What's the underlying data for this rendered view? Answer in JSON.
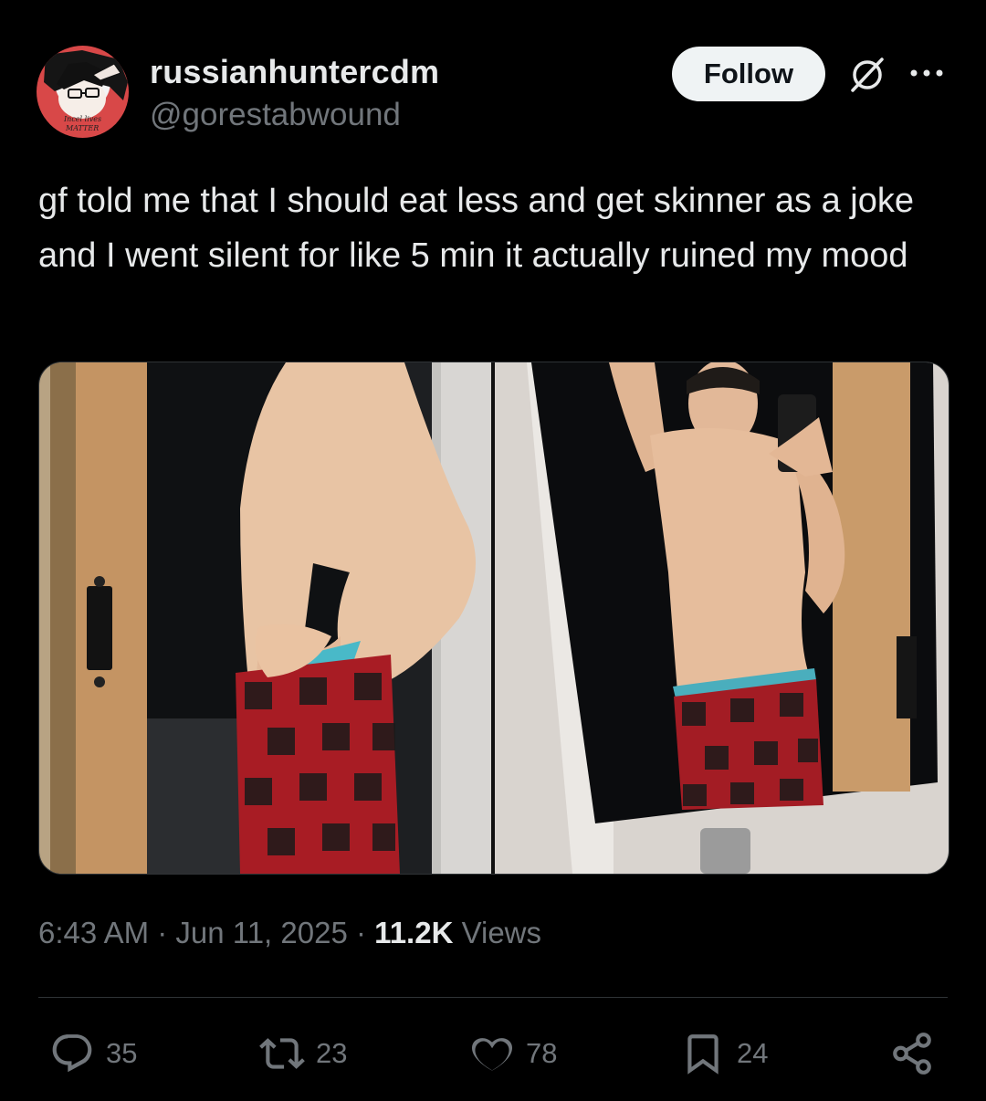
{
  "user": {
    "display_name": "russianhuntercdm",
    "handle": "@gorestabwound",
    "avatar_text": [
      "Incel lives",
      "MATTER"
    ]
  },
  "header": {
    "follow_label": "Follow"
  },
  "tweet": {
    "text": "gf told me that I should eat less and get skinner as a joke and I went silent for like 5 min it actually ruined my mood",
    "time": "6:43 AM",
    "date": "Jun 11, 2025",
    "views_count": "11.2K",
    "views_label": "Views",
    "separator": "·"
  },
  "media": {
    "photo_count": 2
  },
  "actions": {
    "replies": "35",
    "reposts": "23",
    "likes": "78",
    "bookmarks": "24"
  },
  "colors": {
    "background": "#000000",
    "text_primary": "#e7e9ea",
    "text_secondary": "#71767b",
    "follow_bg": "#eff3f4",
    "divider": "#2f3336"
  },
  "icons": [
    "grok-icon",
    "more-icon",
    "reply-icon",
    "repost-icon",
    "like-icon",
    "bookmark-icon",
    "share-icon"
  ]
}
